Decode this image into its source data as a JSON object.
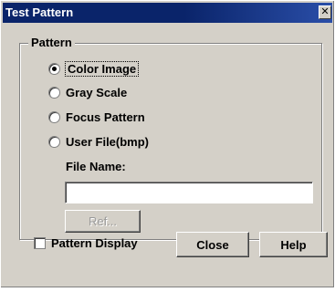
{
  "window": {
    "title": "Test Pattern",
    "close_glyph": "✕"
  },
  "pattern_group": {
    "label": "Pattern",
    "options": [
      {
        "label": "Color Image",
        "checked": true
      },
      {
        "label": "Gray Scale",
        "checked": false
      },
      {
        "label": "Focus Pattern",
        "checked": false
      },
      {
        "label": "User File(bmp)",
        "checked": false
      }
    ],
    "file_name_label": "File Name:",
    "file_name_value": "",
    "ref_button": "Ref..."
  },
  "footer": {
    "pattern_display_label": "Pattern Display",
    "pattern_display_checked": false,
    "close_button": "Close",
    "help_button": "Help"
  }
}
